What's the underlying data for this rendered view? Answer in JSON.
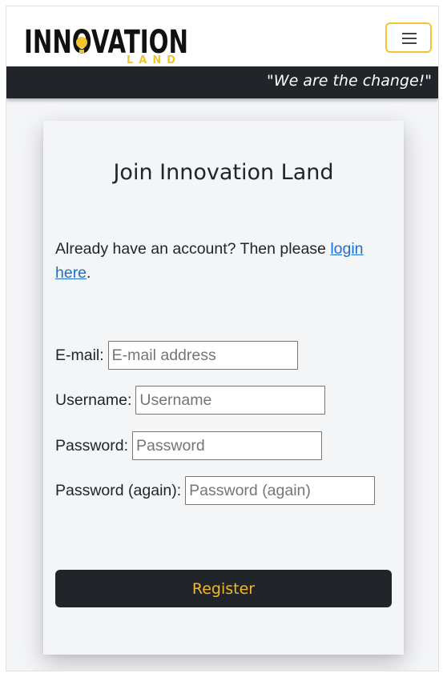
{
  "header": {
    "logo_top": "INNOVATION",
    "logo_bottom": "LAND",
    "slogan": "\"We are the change!\""
  },
  "colors": {
    "brand_yellow": "#f2c42f",
    "dark": "#212529",
    "link": "#1a6fd1",
    "background": "#f4f5f7"
  },
  "icons": {
    "menu": "hamburger-icon",
    "logo_bulb": "lightbulb-icon"
  },
  "form": {
    "title": "Join Innovation Land",
    "intro_prefix": "Already have an account? Then please ",
    "login_link": "login here",
    "intro_suffix": ".",
    "fields": [
      {
        "label": "E-mail:",
        "placeholder": "E-mail address",
        "value": ""
      },
      {
        "label": "Username:",
        "placeholder": "Username",
        "value": ""
      },
      {
        "label": "Password:",
        "placeholder": "Password",
        "value": ""
      },
      {
        "label": "Password (again):",
        "placeholder": "Password (again)",
        "value": ""
      }
    ],
    "submit_label": "Register"
  }
}
